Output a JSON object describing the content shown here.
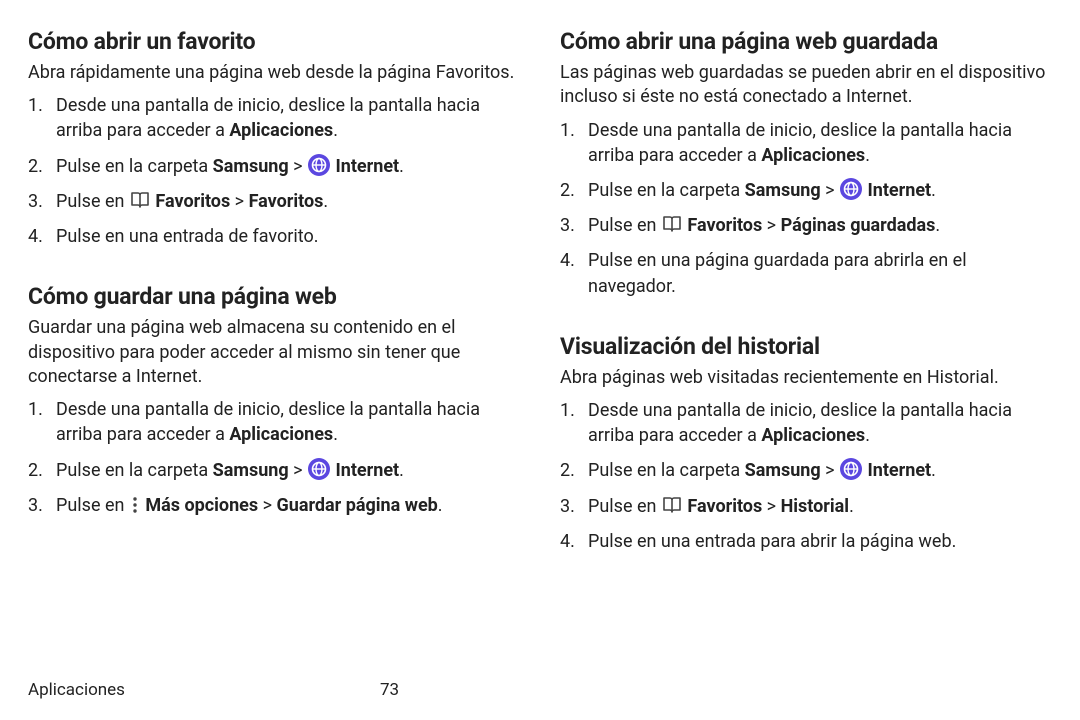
{
  "left": {
    "s1": {
      "heading": "Cómo abrir un favorito",
      "lead": "Abra rápidamente una página web desde la página Favoritos.",
      "items": [
        {
          "prefix": "Desde una pantalla de inicio, deslice la pantalla hacia arriba para acceder a ",
          "bold1": "Aplicaciones",
          "suffix": "."
        },
        {
          "prefix": "Pulse en la carpeta ",
          "bold1": "Samsung",
          "mid": " > ",
          "bold2": "Internet",
          "suffix": ".",
          "icon": "internet"
        },
        {
          "prefix": "Pulse en ",
          "bold1": "Favoritos",
          "mid": " > ",
          "bold2": "Favoritos",
          "suffix": ".",
          "icon": "book"
        },
        {
          "plain": "Pulse en una entrada de favorito."
        }
      ]
    },
    "s2": {
      "heading": "Cómo guardar una página web",
      "lead": "Guardar una página web almacena su contenido en el dispositivo para poder acceder al mismo sin tener que conectarse a Internet.",
      "items": [
        {
          "prefix": "Desde una pantalla de inicio, deslice la pantalla hacia arriba para acceder a ",
          "bold1": "Aplicaciones",
          "suffix": "."
        },
        {
          "prefix": "Pulse en la carpeta ",
          "bold1": "Samsung",
          "mid": " > ",
          "bold2": "Internet",
          "suffix": ".",
          "icon": "internet"
        },
        {
          "prefix": "Pulse en ",
          "bold1": "Más opciones",
          "mid": " > ",
          "bold2": "Guardar página web",
          "suffix": ".",
          "icon": "more"
        }
      ]
    }
  },
  "right": {
    "s3": {
      "heading": "Cómo abrir una página web guardada",
      "lead": "Las páginas web guardadas se pueden abrir en el dispositivo incluso si éste no está conectado a Internet.",
      "items": [
        {
          "prefix": "Desde una pantalla de inicio, deslice la pantalla hacia arriba para acceder a ",
          "bold1": "Aplicaciones",
          "suffix": "."
        },
        {
          "prefix": "Pulse en la carpeta ",
          "bold1": "Samsung",
          "mid": " > ",
          "bold2": "Internet",
          "suffix": ".",
          "icon": "internet"
        },
        {
          "prefix": "Pulse en ",
          "bold1": "Favoritos",
          "mid": " > ",
          "bold2": "Páginas guardadas",
          "suffix": ".",
          "icon": "book"
        },
        {
          "plain": "Pulse en una página guardada para abrirla en el navegador."
        }
      ]
    },
    "s4": {
      "heading": "Visualización del historial",
      "lead": "Abra páginas web visitadas recientemente en Historial.",
      "items": [
        {
          "prefix": "Desde una pantalla de inicio, deslice la pantalla hacia arriba para acceder a ",
          "bold1": "Aplicaciones",
          "suffix": "."
        },
        {
          "prefix": "Pulse en la carpeta ",
          "bold1": "Samsung",
          "mid": " > ",
          "bold2": "Internet",
          "suffix": ".",
          "icon": "internet"
        },
        {
          "prefix": "Pulse en ",
          "bold1": "Favoritos",
          "mid": " > ",
          "bold2": "Historial",
          "suffix": ".",
          "icon": "book"
        },
        {
          "plain": "Pulse en una entrada para abrir la página web."
        }
      ]
    }
  },
  "footer": {
    "section": "Aplicaciones",
    "page": "73"
  }
}
